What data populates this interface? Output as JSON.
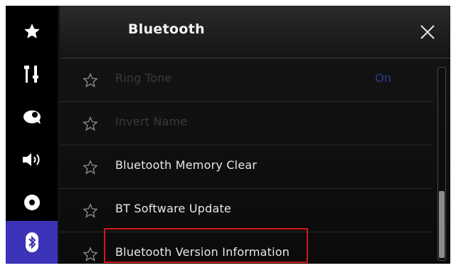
{
  "header": {
    "title": "Bluetooth"
  },
  "sidebar": {
    "items": [
      {
        "icon": "star-icon",
        "active": false
      },
      {
        "icon": "tools-icon",
        "active": false
      },
      {
        "icon": "eye-icon",
        "active": false
      },
      {
        "icon": "speaker-icon",
        "active": false
      },
      {
        "icon": "disc-icon",
        "active": false
      },
      {
        "icon": "bluetooth-icon",
        "active": true
      }
    ]
  },
  "menu": {
    "items": [
      {
        "label": "Ring Tone",
        "value": "On",
        "enabled": false
      },
      {
        "label": "Invert Name",
        "value": "",
        "enabled": false
      },
      {
        "label": "Bluetooth Memory Clear",
        "value": "",
        "enabled": true
      },
      {
        "label": "BT Software Update",
        "value": "",
        "enabled": true
      },
      {
        "label": "Bluetooth Version Information",
        "value": "",
        "enabled": true,
        "highlighted": true
      }
    ]
  },
  "colors": {
    "active_tab": "#3b34b8",
    "highlight_border": "#d01717"
  }
}
